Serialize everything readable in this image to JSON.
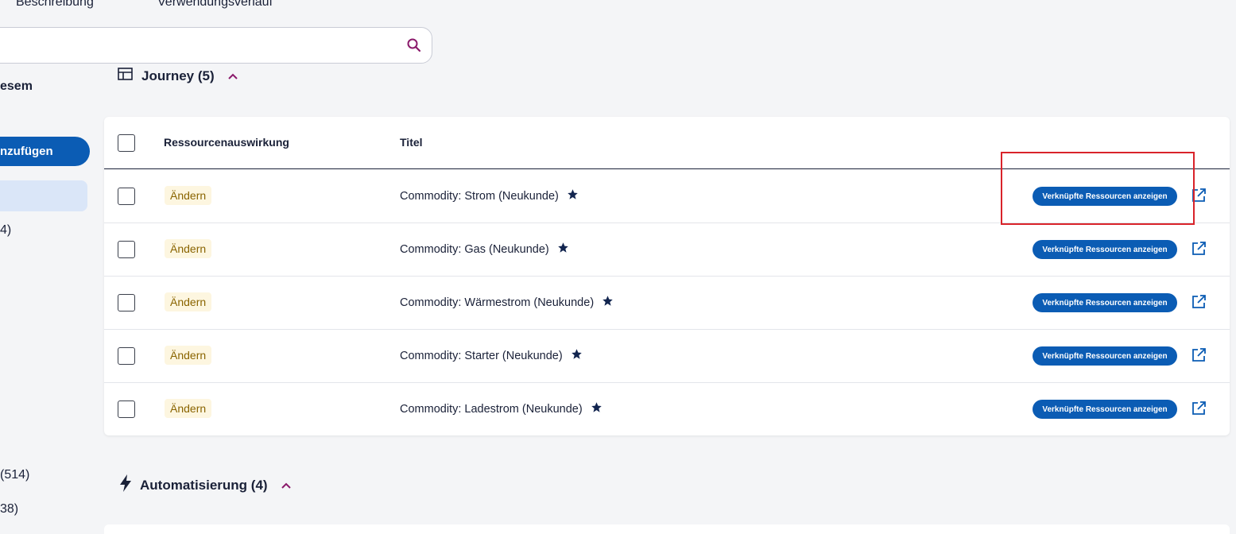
{
  "tabs": [
    "Beschreibung",
    "Verwendungsverlauf"
  ],
  "search": {
    "placeholder": ""
  },
  "sidebar": {
    "heading": "esem",
    "add_button": "nzufügen",
    "counts": [
      "4)",
      "(514)",
      "38)"
    ]
  },
  "journey_section": {
    "title": "Journey (5)"
  },
  "automation_section": {
    "title": "Automatisierung (4)"
  },
  "table": {
    "columns": [
      "Ressourcenauswirkung",
      "Titel"
    ],
    "rows": [
      {
        "impact": "Ändern",
        "title": "Commodity: Strom (Neukunde)",
        "action": "Verknüpfte Ressourcen anzeigen"
      },
      {
        "impact": "Ändern",
        "title": "Commodity: Gas (Neukunde)",
        "action": "Verknüpfte Ressourcen anzeigen"
      },
      {
        "impact": "Ändern",
        "title": "Commodity: Wärmestrom (Neukunde)",
        "action": "Verknüpfte Ressourcen anzeigen"
      },
      {
        "impact": "Ändern",
        "title": "Commodity: Starter (Neukunde)",
        "action": "Verknüpfte Ressourcen anzeigen"
      },
      {
        "impact": "Ändern",
        "title": "Commodity: Ladestrom (Neukunde)",
        "action": "Verknüpfte Ressourcen anzeigen"
      }
    ]
  },
  "colors": {
    "primary": "#0b5cb4",
    "text": "#1a2138",
    "badge_bg": "#fdf6e0",
    "badge_text": "#8a6400",
    "highlight": "#d9232a",
    "accent": "#8b1a6b"
  },
  "icons": [
    "search-icon",
    "journey-icon",
    "chevron-up-icon",
    "star-icon",
    "external-link-icon",
    "lightning-icon"
  ]
}
